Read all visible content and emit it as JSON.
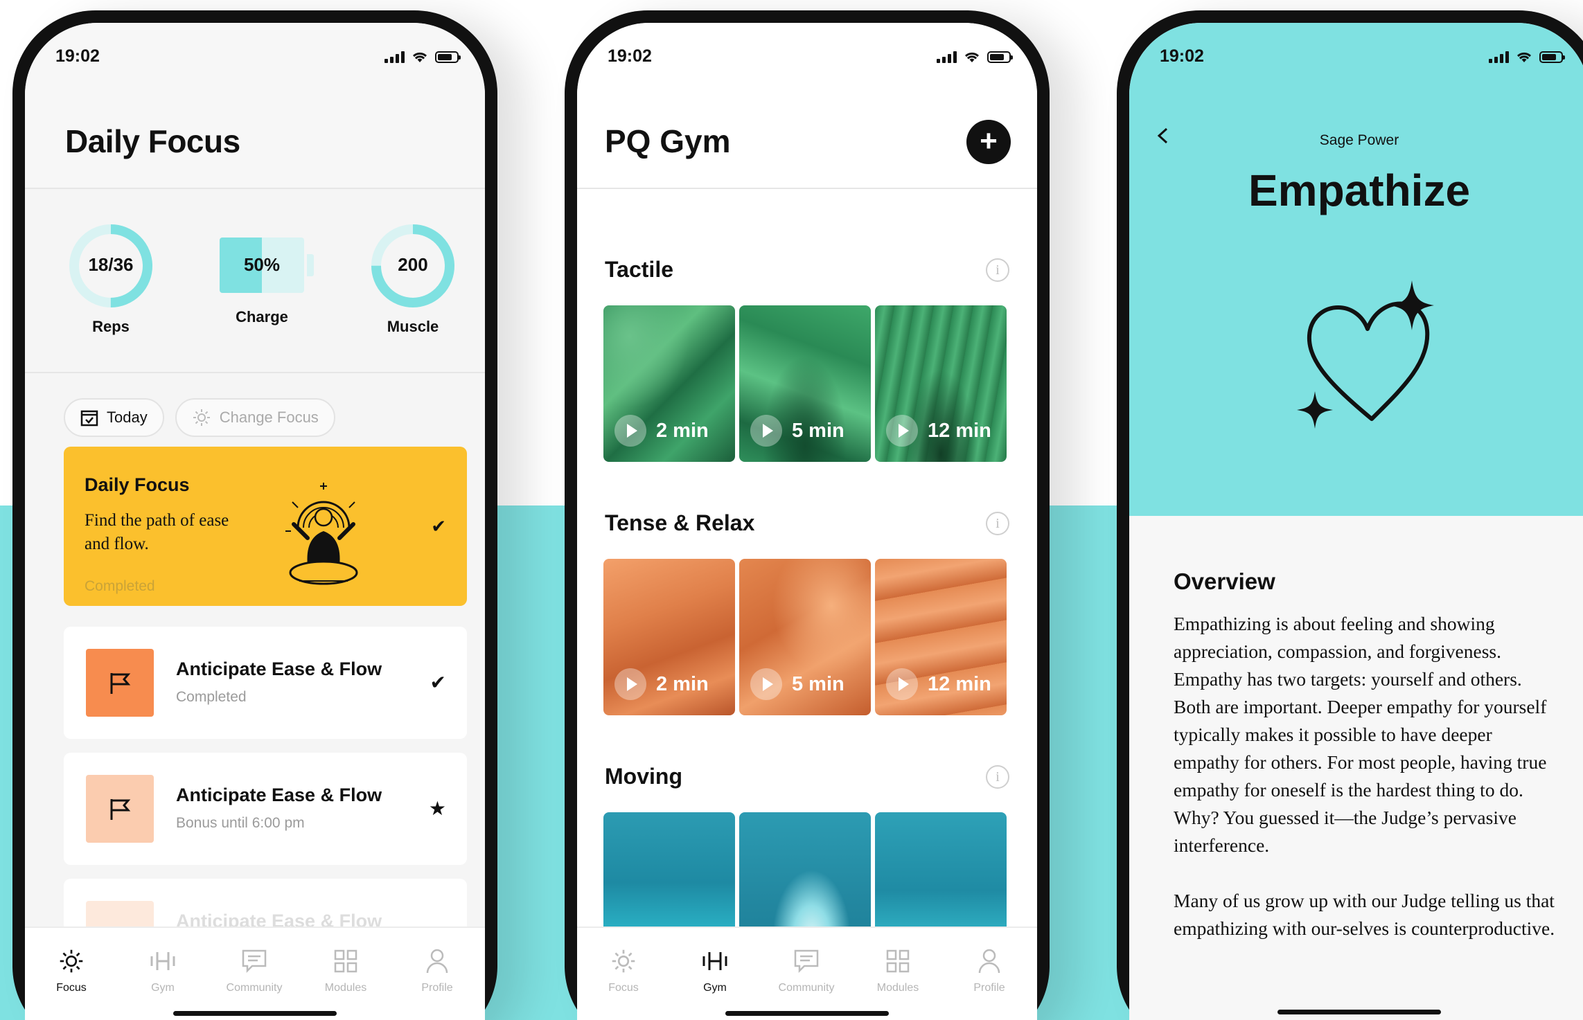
{
  "status_time": "19:02",
  "colors": {
    "teal": "#7FE1E1",
    "yellow": "#FBC02D",
    "orange": "#F78C4F",
    "peach": "#FBCCAF"
  },
  "tabbar": [
    {
      "label": "Focus",
      "icon": "sun-icon"
    },
    {
      "label": "Gym",
      "icon": "dumbbell-icon"
    },
    {
      "label": "Community",
      "icon": "chat-icon"
    },
    {
      "label": "Modules",
      "icon": "grid-icon"
    },
    {
      "label": "Profile",
      "icon": "person-icon"
    }
  ],
  "focus_screen": {
    "title": "Daily Focus",
    "stats": {
      "reps": {
        "value": "18/36",
        "label": "Reps",
        "progress": 0.5
      },
      "charge": {
        "value": "50%",
        "label": "Charge",
        "progress": 0.5
      },
      "muscle": {
        "value": "200",
        "label": "Muscle",
        "progress": 0.75
      }
    },
    "chips": {
      "today": "Today",
      "change_focus": "Change Focus"
    },
    "card": {
      "title": "Daily Focus",
      "text": "Find the path of ease and flow.",
      "status": "Completed",
      "check": "✔"
    },
    "tasks": [
      {
        "title": "Anticipate Ease & Flow",
        "sub": "Completed",
        "mark": "✔",
        "icon": "flag-icon"
      },
      {
        "title": "Anticipate Ease & Flow",
        "sub": "Bonus until 6:00 pm",
        "mark": "★",
        "icon": "flag-icon"
      },
      {
        "title": "Anticipate Ease & Flow",
        "sub": "",
        "mark": "",
        "icon": "flag-icon"
      }
    ],
    "active_tab": "Focus"
  },
  "gym_screen": {
    "title": "PQ Gym",
    "add_label": "+",
    "sections": [
      {
        "title": "Tactile",
        "tiles": [
          "2 min",
          "5 min",
          "12 min"
        ]
      },
      {
        "title": "Tense & Relax",
        "tiles": [
          "2 min",
          "5 min",
          "12 min"
        ]
      },
      {
        "title": "Moving",
        "tiles": [
          "",
          "",
          ""
        ]
      }
    ],
    "active_tab": "Gym"
  },
  "detail_screen": {
    "subtitle": "Sage Power",
    "title": "Empathize",
    "overview_title": "Overview",
    "paragraphs": [
      "Empathizing is about feeling and showing appreciation, compassion, and forgiveness. Empathy has two targets: yourself and others. Both are important. Deeper empathy for yourself typically makes it possible to have deeper empathy for others. For most people, having true empathy for oneself is the hardest thing to do. Why? You guessed it—the Judge’s pervasive interference.",
      "Many of us grow up with our Judge telling us that empathizing with our-selves is counterproductive."
    ]
  }
}
